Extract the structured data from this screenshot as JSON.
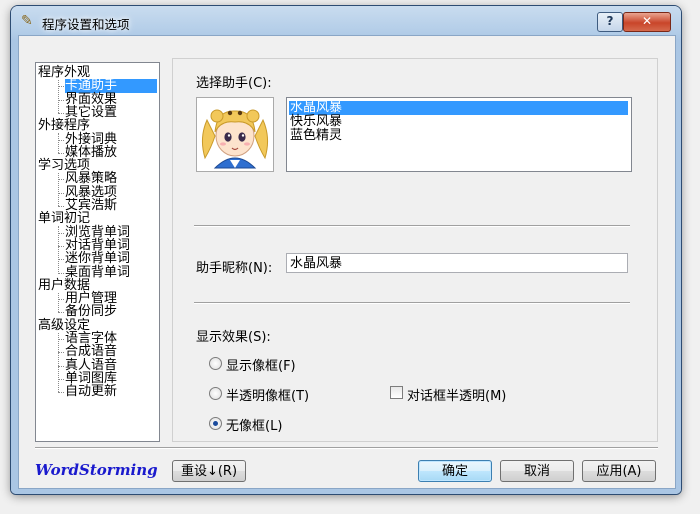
{
  "window": {
    "title": "程序设置和选项",
    "help_label": "?",
    "close_label": "✕"
  },
  "tree": {
    "groups": [
      {
        "label": "程序外观",
        "children": [
          "卡通助手",
          "界面效果",
          "其它设置"
        ]
      },
      {
        "label": "外接程序",
        "children": [
          "外接词典",
          "媒体播放"
        ]
      },
      {
        "label": "学习选项",
        "children": [
          "风暴策略",
          "风暴选项",
          "艾宾浩斯"
        ]
      },
      {
        "label": "单词初记",
        "children": [
          "浏览背单词",
          "对话背单词",
          "迷你背单词",
          "桌面背单词"
        ]
      },
      {
        "label": "用户数据",
        "children": [
          "用户管理",
          "备份同步"
        ]
      },
      {
        "label": "高级设定",
        "children": [
          "语言字体",
          "合成语音",
          "真人语音",
          "单词图库",
          "自动更新"
        ]
      }
    ],
    "selected": "卡通助手"
  },
  "assistant": {
    "section_label": "选择助手(C):",
    "options": [
      "水晶风暴",
      "快乐风暴",
      "蓝色精灵"
    ],
    "selected": "水晶风暴",
    "nickname_label": "助手昵称(N):",
    "nickname_value": "水晶风暴"
  },
  "display": {
    "section_label": "显示效果(S):",
    "opt_frame": "显示像框(F)",
    "opt_semi": "半透明像框(T)",
    "opt_none": "无像框(L)",
    "selected": "无像框(L)",
    "dialog_semi_label": "对话框半透明(M)",
    "dialog_semi_checked": false
  },
  "footer": {
    "brand": "WordStorming",
    "reset_label": "重设↓(R)",
    "ok_label": "确定",
    "cancel_label": "取消",
    "apply_label": "应用(A)"
  },
  "colors": {
    "selection": "#3399ff",
    "brand": "#1a1acd"
  }
}
